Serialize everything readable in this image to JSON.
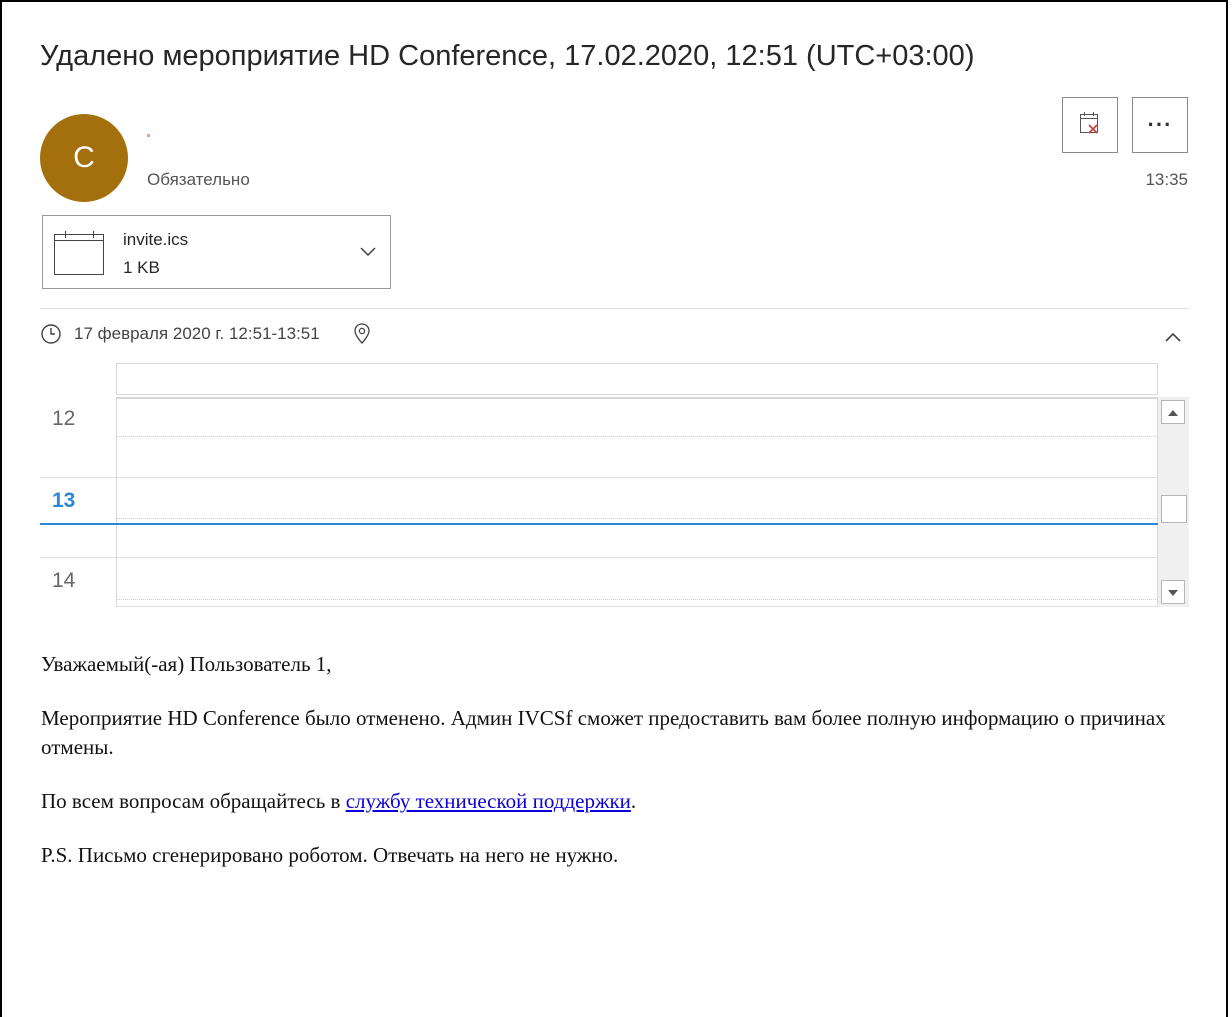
{
  "message": {
    "subject": "Удалено мероприятие HD Conference, 17.02.2020, 12:51 (UTC+03:00)",
    "sender_initial": "C",
    "importance": "Обязательно",
    "received_time": "13:35"
  },
  "toolbar": {
    "remove_from_calendar_icon": "calendar-remove-icon",
    "more_label": "···"
  },
  "attachment": {
    "name": "invite.ics",
    "size": "1 KB",
    "icon": "calendar-file-icon"
  },
  "event": {
    "when": "17 февраля 2020 г. 12:51-13:51",
    "clock_icon": "clock-icon",
    "location_icon": "map-pin-icon"
  },
  "calendar": {
    "hours": [
      "12",
      "13",
      "14"
    ],
    "current_hour": "13"
  },
  "body": {
    "greeting": "Уважаемый(-ая) Пользователь 1,",
    "cancel_text": "Мероприятие HD Conference было отменено. Админ IVCSf сможет предоставить вам более полную информацию о причинах отмены.",
    "support_prefix": "По всем вопросам обращайтесь в ",
    "support_link": "службу технической поддержки",
    "support_suffix": ".",
    "ps": "P.S. Письмо сгенерировано роботом. Отвечать на него не нужно."
  },
  "colors": {
    "avatar": "#a46f0d",
    "accent": "#2b88d8",
    "link": "#0b00d6"
  }
}
